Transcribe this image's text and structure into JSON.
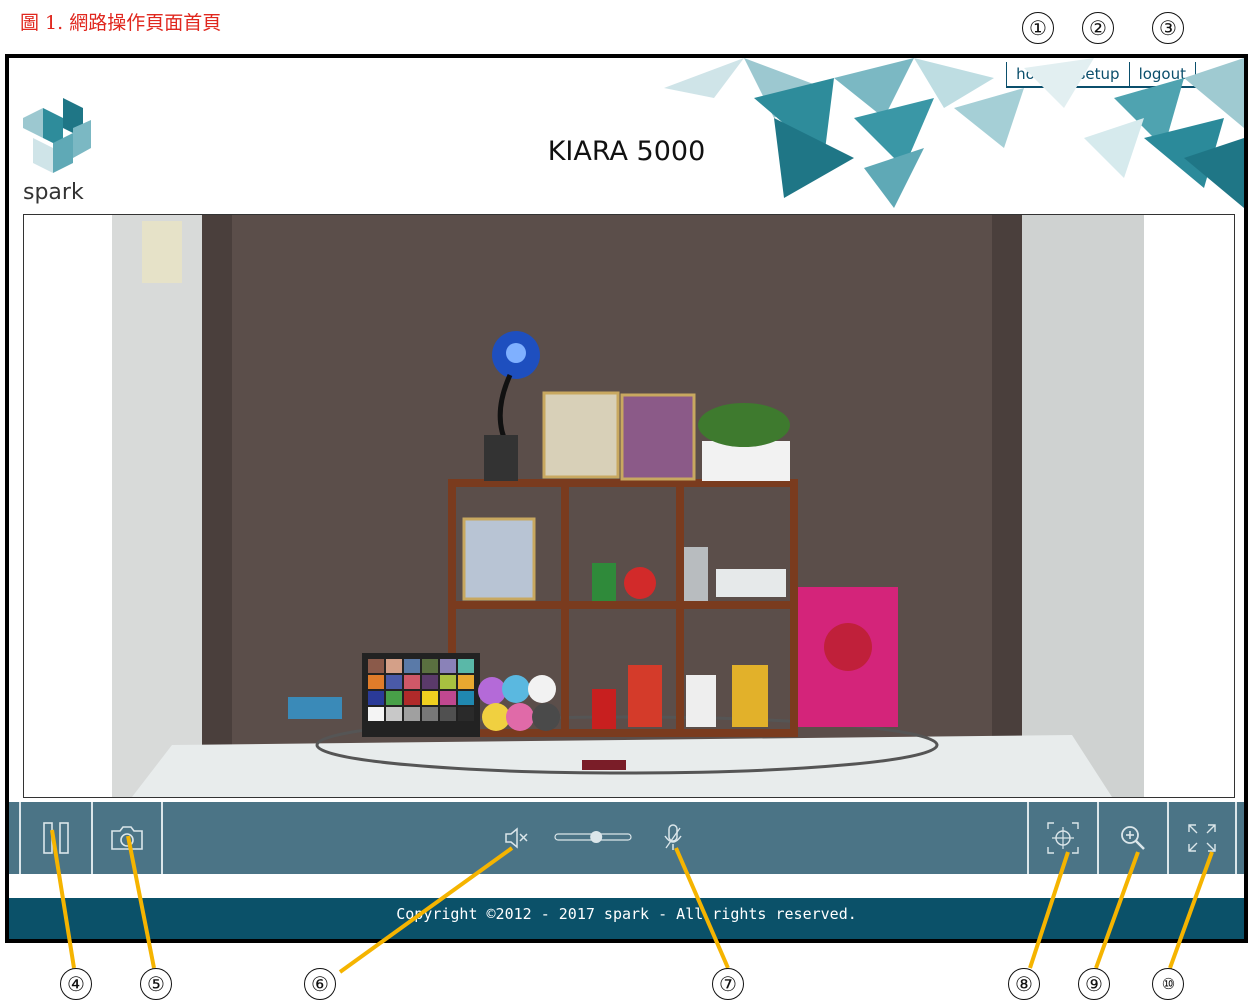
{
  "caption": "圖 1. 網路操作頁面首頁",
  "callouts": {
    "top": [
      "①",
      "②",
      "③"
    ],
    "bottom": [
      "④",
      "⑤",
      "⑥",
      "⑦",
      "⑧",
      "⑨",
      "⑩"
    ]
  },
  "nav": {
    "home": "home",
    "setup": "setup",
    "logout": "logout"
  },
  "header": {
    "logo_text": "spark",
    "title": "KIARA 5000"
  },
  "video": {
    "scene": {
      "color_checker_label": "",
      "colors": {
        "wall": "#5b4e4a",
        "table": "#e8ecec",
        "shelf": "#7a3b1e"
      }
    }
  },
  "controls": {
    "pause_icon": "pause-icon",
    "snapshot_icon": "camera-icon",
    "mute_icon": "speaker-mute-icon",
    "volume_level": 0.55,
    "mic_icon": "microphone-icon",
    "ptz_icon": "crosshair-icon",
    "zoom_icon": "zoom-in-icon",
    "fullscreen_icon": "fullscreen-icon"
  },
  "footer": {
    "copyright": "Copyright ©2012 - 2017 spark - All rights reserved."
  },
  "colors": {
    "control_bar": "#4b7486",
    "footer": "#0b5169",
    "accent": "#2b8a9a",
    "caption": "#e0271e",
    "callout_line": "#f5b400"
  }
}
